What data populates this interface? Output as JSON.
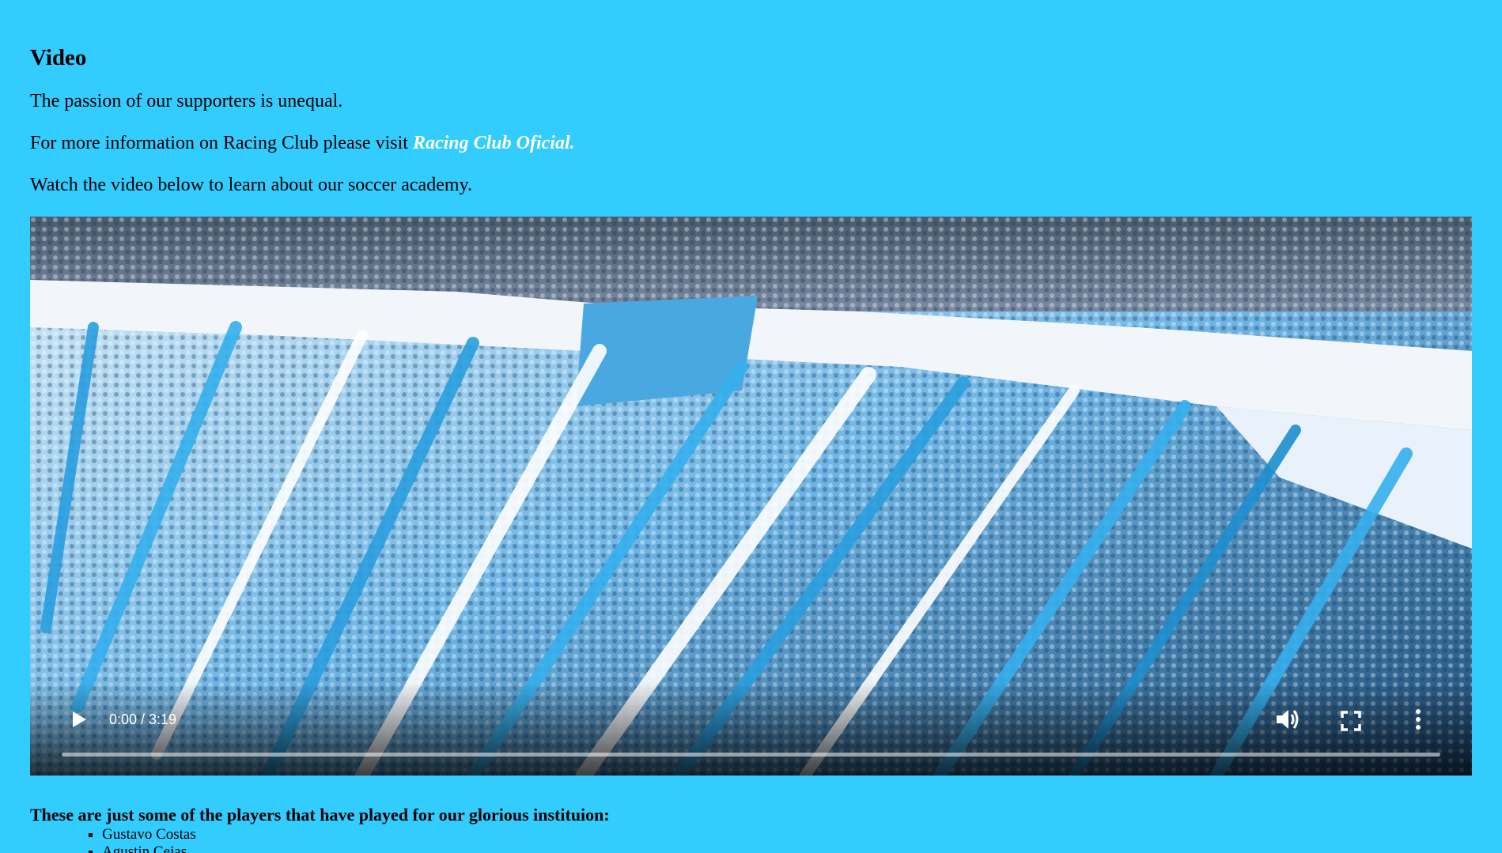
{
  "page": {
    "heading": "Video",
    "intro": "The passion of our supporters is unequal.",
    "info_prefix": "For more information on Racing Club please visit ",
    "info_link": "Racing Club Oficial.",
    "watch_text": "Watch the video below to learn about our soccer academy."
  },
  "video": {
    "time": "0:00 / 3:19",
    "progress_fraction": 0,
    "play_icon": "play-icon",
    "volume_icon": "volume-icon",
    "fullscreen_icon": "fullscreen-icon",
    "more_icon": "more-vertical-icon"
  },
  "players": {
    "heading": "These are just some of the players that have played for our glorious instituion:",
    "list": [
      "Gustavo Costas",
      "Agustin Cejas"
    ]
  },
  "colors": {
    "background": "#33ccff",
    "link": "#ffffff",
    "video_bg": "#000000"
  }
}
